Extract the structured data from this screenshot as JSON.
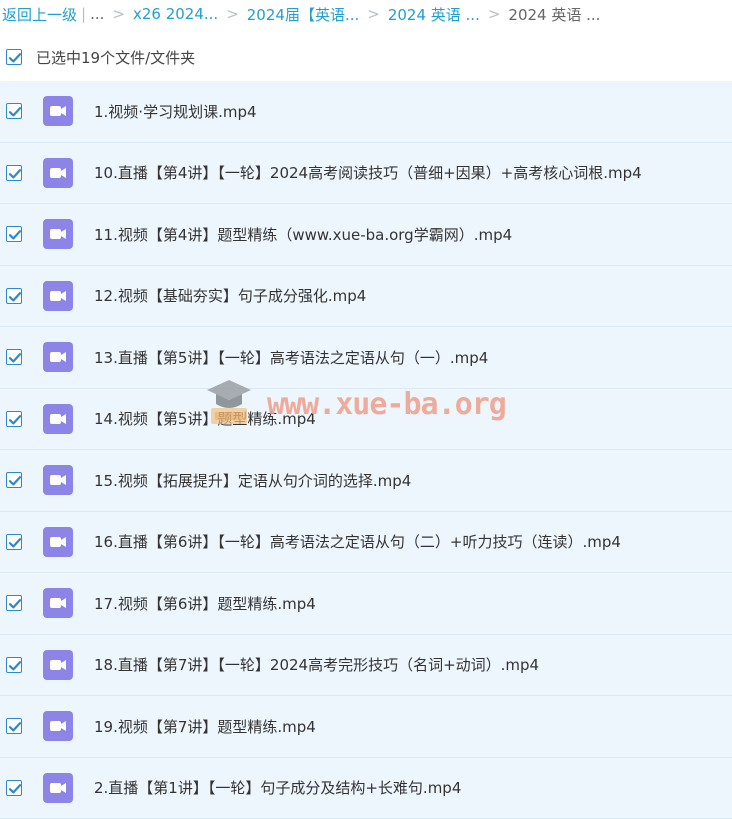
{
  "breadcrumb": {
    "back": "返回上一级",
    "sep": "|",
    "ellipsis": "...",
    "items": [
      {
        "label": "x26 2024..."
      },
      {
        "label": "2024届【英语..."
      },
      {
        "label": "2024 英语 ..."
      },
      {
        "label": "2024 英语 ..."
      }
    ]
  },
  "selection": {
    "label": "已选中19个文件/文件夹",
    "checked": true
  },
  "files": [
    {
      "name": "1.视频·学习规划课.mp4",
      "checked": true,
      "icon": "video-file-icon"
    },
    {
      "name": "10.直播【第4讲】【一轮】2024高考阅读技巧（普细+因果）+高考核心词根.mp4",
      "checked": true,
      "icon": "video-file-icon"
    },
    {
      "name": "11.视频【第4讲】题型精练（www.xue-ba.org学霸网）.mp4",
      "checked": true,
      "icon": "video-file-icon"
    },
    {
      "name": "12.视频【基础夯实】句子成分强化.mp4",
      "checked": true,
      "icon": "video-file-icon"
    },
    {
      "name": "13.直播【第5讲】【一轮】高考语法之定语从句（一）.mp4",
      "checked": true,
      "icon": "video-file-icon"
    },
    {
      "name": "14.视频【第5讲】题型精练.mp4",
      "checked": true,
      "icon": "video-file-icon"
    },
    {
      "name": "15.视频【拓展提升】定语从句介词的选择.mp4",
      "checked": true,
      "icon": "video-file-icon"
    },
    {
      "name": "16.直播【第6讲】【一轮】高考语法之定语从句（二）+听力技巧（连读）.mp4",
      "checked": true,
      "icon": "video-file-icon"
    },
    {
      "name": "17.视频【第6讲】题型精练.mp4",
      "checked": true,
      "icon": "video-file-icon"
    },
    {
      "name": "18.直播【第7讲】【一轮】2024高考完形技巧（名词+动词）.mp4",
      "checked": true,
      "icon": "video-file-icon"
    },
    {
      "name": "19.视频【第7讲】题型精练.mp4",
      "checked": true,
      "icon": "video-file-icon"
    },
    {
      "name": "2.直播【第1讲】【一轮】句子成分及结构+长难句.mp4",
      "checked": true,
      "icon": "video-file-icon"
    }
  ],
  "watermark": {
    "text": "www.xue-ba.org"
  },
  "colors": {
    "link": "#1e9fd6",
    "row_bg": "#eef6fd",
    "checkbox": "#2c89d0",
    "video_icon": "#8c84e6"
  }
}
